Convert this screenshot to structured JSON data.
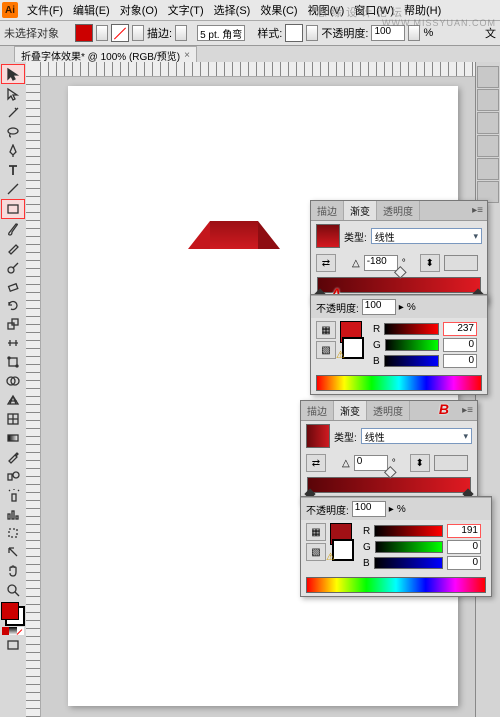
{
  "menu": {
    "file": "文件(F)",
    "edit": "编辑(E)",
    "object": "对象(O)",
    "type": "文字(T)",
    "select": "选择(S)",
    "effect": "效果(C)",
    "view": "视图(V)",
    "window": "窗口(W)",
    "help": "帮助(H)"
  },
  "controlbar": {
    "noselection": "未选择对象",
    "stroke_label": "描边:",
    "stroke_val": "5 pt. 角弯",
    "style_label": "样式:",
    "opacity_label": "不透明度:",
    "opacity_val": "100",
    "pct": "%",
    "more": "文"
  },
  "tab": {
    "title": "折叠字体效果* @ 100% (RGB/预览)",
    "close": "×"
  },
  "watermarks": {
    "top": "思缘设计论坛",
    "url": "WWW.MISSYUAN.COM"
  },
  "panelA": {
    "tabs": {
      "stroke": "描边",
      "grad": "渐变",
      "trans": "透明度"
    },
    "type_label": "类型:",
    "type_val": "线性",
    "angle": "-180",
    "angle_deg": "°",
    "marker": "A",
    "opacity_label": "不透明度:",
    "opacity_val": "100",
    "pct": "%",
    "r_label": "R",
    "g_label": "G",
    "b_label": "B",
    "r_val": "237",
    "g_val": "0",
    "b_val": "0"
  },
  "panelB": {
    "tabs": {
      "stroke": "描边",
      "grad": "渐变",
      "trans": "透明度"
    },
    "type_label": "类型:",
    "type_val": "线性",
    "angle": "0",
    "angle_deg": "°",
    "marker": "B",
    "opacity_label": "不透明度:",
    "opacity_val": "100",
    "pct": "%",
    "r_label": "R",
    "g_label": "G",
    "b_label": "B",
    "r_val": "191",
    "g_val": "0",
    "b_val": "0"
  },
  "chart_data": null
}
